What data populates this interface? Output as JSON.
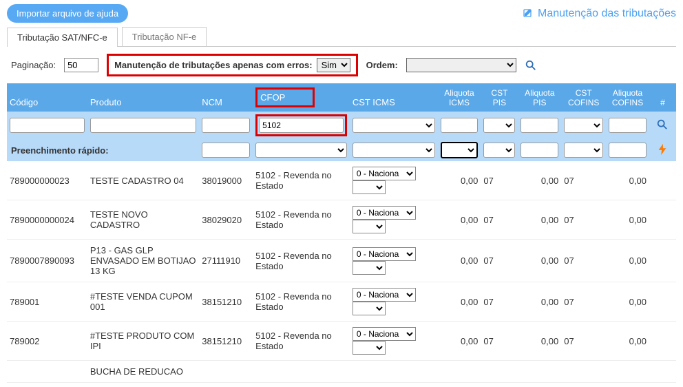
{
  "topbar": {
    "import_button": "Importar arquivo de ajuda",
    "maintenance_link": "Manutenção das tributações"
  },
  "tabs": {
    "sat": "Tributação SAT/NFC-e",
    "nfe": "Tributação NF-e"
  },
  "controls": {
    "pagination_label": "Paginação:",
    "pagination_value": "50",
    "errors_label": "Manutenção de tributações apenas com erros:",
    "errors_value": "Sim",
    "order_label": "Ordem:",
    "order_value": ""
  },
  "columns": {
    "codigo": "Código",
    "produto": "Produto",
    "ncm": "NCM",
    "cfop": "CFOP",
    "csticms": "CST ICMS",
    "aliqicms": "Aliquota ICMS",
    "cstpis": "CST PIS",
    "aliqpis": "Aliquota PIS",
    "cstcofins": "CST COFINS",
    "aliqcofins": "Aliquota COFINS",
    "hash": "#"
  },
  "filters": {
    "cfop": "5102"
  },
  "quick": {
    "label": "Preenchimento rápido:"
  },
  "rows": [
    {
      "codigo": "789000000023",
      "produto": "TESTE CADASTRO 04",
      "ncm": "38019000",
      "cfop": "5102 - Revenda no Estado",
      "csticms": "0 - Naciona",
      "aliqicms": "0,00",
      "cstpis": "07",
      "aliqpis": "0,00",
      "cstcofins": "07",
      "aliqcofins": "0,00"
    },
    {
      "codigo": "7890000000024",
      "produto": "TESTE NOVO CADASTRO",
      "ncm": "38029020",
      "cfop": "5102 - Revenda no Estado",
      "csticms": "0 - Naciona",
      "aliqicms": "0,00",
      "cstpis": "07",
      "aliqpis": "0,00",
      "cstcofins": "07",
      "aliqcofins": "0,00"
    },
    {
      "codigo": "7890007890093",
      "produto": "P13 - GAS GLP ENVASADO EM BOTIJAO 13 KG",
      "ncm": "27111910",
      "cfop": "5102 - Revenda no Estado",
      "csticms": "0 - Naciona",
      "aliqicms": "0,00",
      "cstpis": "07",
      "aliqpis": "0,00",
      "cstcofins": "07",
      "aliqcofins": "0,00"
    },
    {
      "codigo": "789001",
      "produto": "#TESTE VENDA CUPOM 001",
      "ncm": "38151210",
      "cfop": "5102 - Revenda no Estado",
      "csticms": "0 - Naciona",
      "aliqicms": "0,00",
      "cstpis": "07",
      "aliqpis": "0,00",
      "cstcofins": "07",
      "aliqcofins": "0,00"
    },
    {
      "codigo": "789002",
      "produto": "#TESTE PRODUTO COM IPI",
      "ncm": "38151210",
      "cfop": "5102 - Revenda no Estado",
      "csticms": "0 - Naciona",
      "aliqicms": "0,00",
      "cstpis": "07",
      "aliqpis": "0,00",
      "cstcofins": "07",
      "aliqcofins": "0,00"
    }
  ],
  "partial_row": {
    "produto": "BUCHA DE REDUCAO"
  }
}
